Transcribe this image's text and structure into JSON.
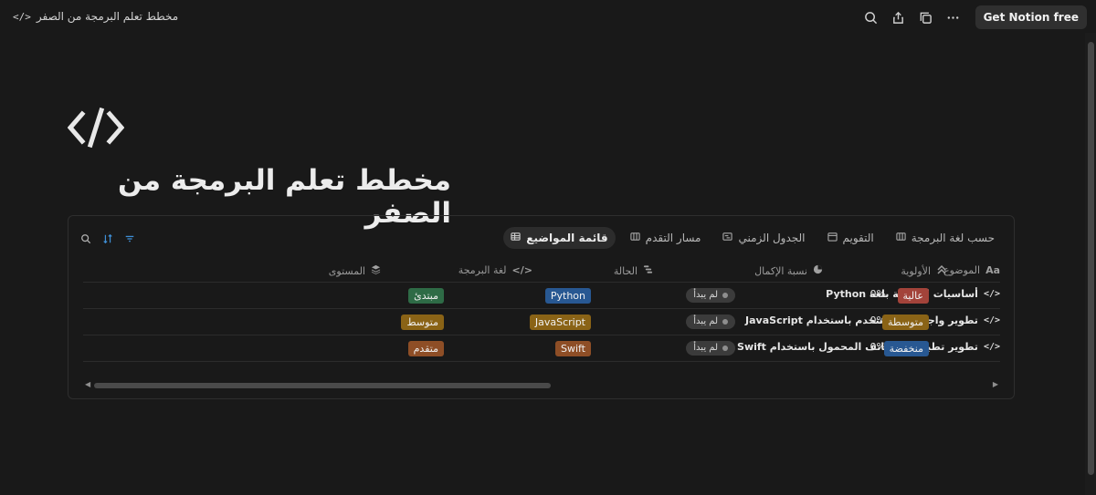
{
  "topbar": {
    "breadcrumb_icon": "</>",
    "breadcrumb_title": "مخطط تعلم البرمجة من الصفر",
    "cta_label": "Get Notion free",
    "icons": [
      "search-icon",
      "share-icon",
      "duplicate-icon",
      "more-icon"
    ]
  },
  "page": {
    "icon": "code-icon",
    "title": "مخطط تعلم البرمجة من الصفر"
  },
  "views": {
    "tabs": [
      {
        "label": "قائمة المواضيع",
        "icon": "table-icon",
        "active": true
      },
      {
        "label": "مسار التقدم",
        "icon": "board-icon",
        "active": false
      },
      {
        "label": "الجدول الزمني",
        "icon": "timeline-icon",
        "active": false
      },
      {
        "label": "التقويم",
        "icon": "calendar-icon",
        "active": false
      },
      {
        "label": "حسب لغة البرمجة",
        "icon": "board-icon",
        "active": false
      }
    ],
    "tools": [
      "search-icon",
      "sort-icon",
      "filter-icon"
    ]
  },
  "table": {
    "columns": {
      "topic": "الموضوع",
      "topic_icon": "Aa",
      "level": "المستوى",
      "language": "لغة البرمجة",
      "status": "الحالة",
      "completion": "نسبة الإكمال",
      "priority": "الأولوية"
    },
    "rows": [
      {
        "topic": "أساسيات البرمجة بلغة Python",
        "level": "مبتدئ",
        "language": "Python",
        "status": "لم يبدأ",
        "completion": "0%",
        "priority": "عالية"
      },
      {
        "topic": "تطوير واجهات المستخدم باستخدام JavaScript",
        "level": "متوسط",
        "language": "JavaScript",
        "status": "لم يبدأ",
        "completion": "0%",
        "priority": "متوسطة"
      },
      {
        "topic": "تطوير تطبيقات الهاتف المحمول باستخدام Swift",
        "level": "متقدم",
        "language": "Swift",
        "status": "لم يبدأ",
        "completion": "0%",
        "priority": "منخفضة"
      }
    ],
    "code_marker": "</>"
  },
  "colors": {
    "level_beginner": "#2e6b46",
    "level_intermediate": "#8a6316",
    "level_advanced": "#8e4e26",
    "lang_python": "#285892",
    "lang_js": "#8a6316",
    "lang_swift": "#8e4e26",
    "priority_high": "#a3433a",
    "priority_medium": "#8a6316",
    "priority_low": "#285892",
    "accent_blue": "#3f8fd6"
  }
}
